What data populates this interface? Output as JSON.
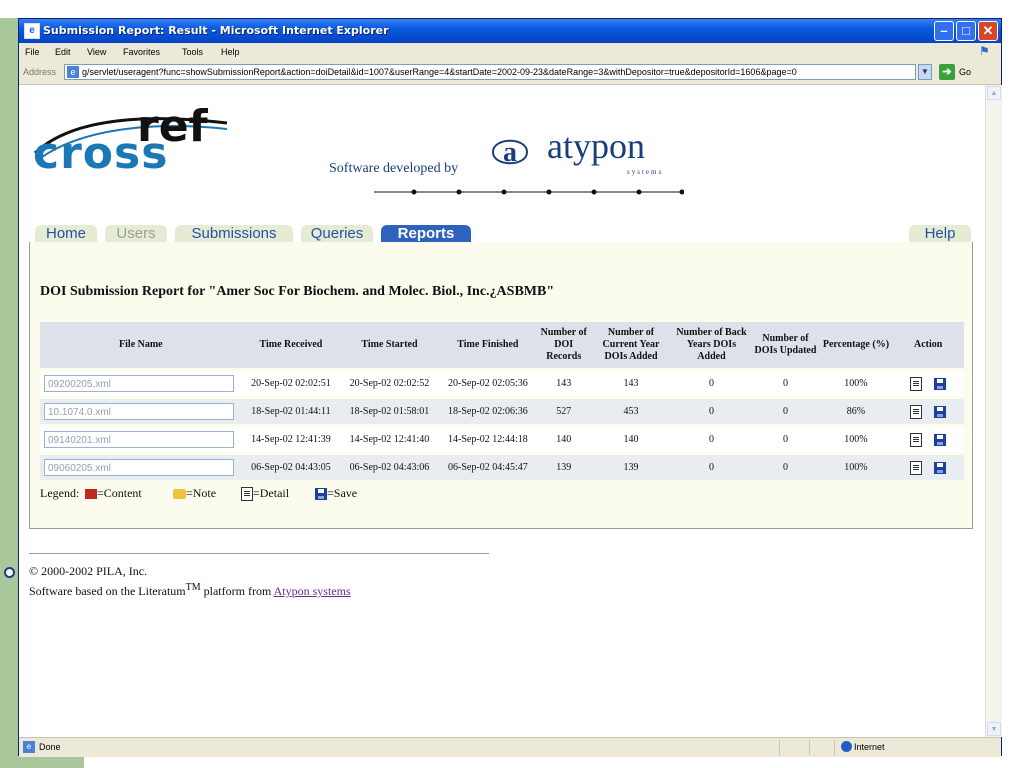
{
  "window": {
    "title": "Submission Report: Result - Microsoft Internet Explorer",
    "min": "–",
    "max": "□",
    "close": "✕"
  },
  "menu": [
    "File",
    "Edit",
    "View",
    "Favorites",
    "Tools",
    "Help"
  ],
  "address": {
    "label": "Address",
    "url": "g/servlet/useragent?func=showSubmissionReport&action=doiDetail&id=1007&userRange=4&startDate=2002-09-23&dateRange=3&withDepositor=true&depositorId=1606&page=0",
    "go": "Go"
  },
  "brand": {
    "cross": "cross",
    "ref": "ref",
    "developed_by": "Software developed by",
    "atypon_letter": "a",
    "atypon": "atypon",
    "atypon_sub": "systems"
  },
  "tabs": {
    "home": "Home",
    "users": "Users",
    "submissions": "Submissions",
    "queries": "Queries",
    "reports": "Reports",
    "help": "Help"
  },
  "report": {
    "title": "DOI Submission Report for \"Amer Soc For Biochem. and Molec. Biol., Inc.¿ASBMB\"",
    "headers": {
      "file_name": "File Name",
      "time_received": "Time Received",
      "time_started": "Time Started",
      "time_finished": "Time Finished",
      "doi_records": "Number of DOI Records",
      "current_year": "Number of Current Year DOIs Added",
      "back_years": "Number of Back Years DOIs Added",
      "dois_updated": "Number of DOIs Updated",
      "percentage": "Percentage (%)",
      "action": "Action"
    },
    "rows": [
      {
        "file": "09200205.xml",
        "received": "20-Sep-02 02:02:51",
        "started": "20-Sep-02 02:02:52",
        "finished": "20-Sep-02 02:05:36",
        "records": "143",
        "current": "143",
        "back": "0",
        "updated": "0",
        "pct": "100%"
      },
      {
        "file": "10.1074.0.xml",
        "received": "18-Sep-02 01:44:11",
        "started": "18-Sep-02 01:58:01",
        "finished": "18-Sep-02 02:06:36",
        "records": "527",
        "current": "453",
        "back": "0",
        "updated": "0",
        "pct": "86%"
      },
      {
        "file": "09140201.xml",
        "received": "14-Sep-02 12:41:39",
        "started": "14-Sep-02 12:41:40",
        "finished": "14-Sep-02 12:44:18",
        "records": "140",
        "current": "140",
        "back": "0",
        "updated": "0",
        "pct": "100%"
      },
      {
        "file": "09060205.xml",
        "received": "06-Sep-02 04:43:05",
        "started": "06-Sep-02 04:43:06",
        "finished": "06-Sep-02 04:45:47",
        "records": "139",
        "current": "139",
        "back": "0",
        "updated": "0",
        "pct": "100%"
      }
    ]
  },
  "legend": {
    "label": "Legend:",
    "content": "=Content",
    "note": "=Note",
    "detail": "=Detail",
    "save": "=Save"
  },
  "footer": {
    "copyright": "© 2000-2002 PILA, Inc.",
    "software_prefix": "Software based on the Literatum",
    "tm": "TM",
    "software_middle": " platform from ",
    "link": "Atypon systems"
  },
  "status": {
    "text": "Done",
    "zone": "Internet"
  },
  "colors": {
    "tab_active": "#2d63bd",
    "cross_blue": "#1b77b5",
    "atypon_navy": "#1a3d7c",
    "slide_green": "#a8c79a"
  }
}
